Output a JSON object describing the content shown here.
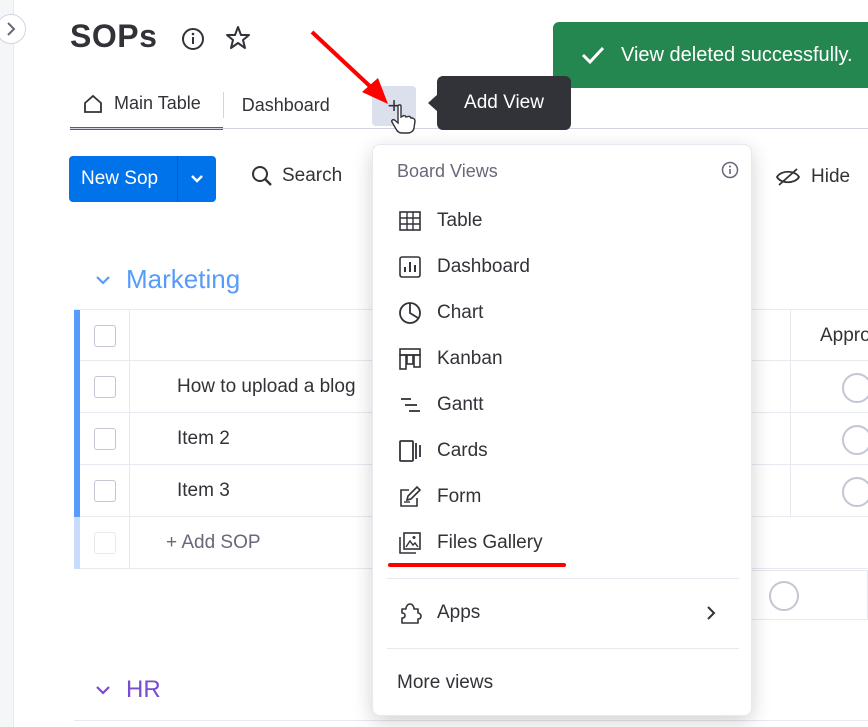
{
  "board": {
    "title": "SOPs"
  },
  "toast": {
    "message": "View deleted successfully."
  },
  "tabs": {
    "main": "Main Table",
    "dashboard": "Dashboard",
    "add": "+"
  },
  "tooltip": {
    "text": "Add View"
  },
  "toolbar": {
    "new_label": "New Sop",
    "search_label": "Search",
    "hide_label": "Hide"
  },
  "groups": {
    "marketing": {
      "title": "Marketing",
      "color": "#579bfc",
      "rows": [
        {
          "name": "How to upload a blog"
        },
        {
          "name": "Item 2"
        },
        {
          "name": "Item 3"
        }
      ],
      "add_label": "+ Add SOP",
      "column_approved": "Appro"
    },
    "hr": {
      "title": "HR",
      "color": "#784bd1"
    }
  },
  "menu": {
    "section_title": "Board Views",
    "items": [
      {
        "label": "Table",
        "icon": "table-icon"
      },
      {
        "label": "Dashboard",
        "icon": "dashboard-icon"
      },
      {
        "label": "Chart",
        "icon": "chart-icon"
      },
      {
        "label": "Kanban",
        "icon": "kanban-icon"
      },
      {
        "label": "Gantt",
        "icon": "gantt-icon"
      },
      {
        "label": "Cards",
        "icon": "cards-icon"
      },
      {
        "label": "Form",
        "icon": "form-icon"
      },
      {
        "label": "Files Gallery",
        "icon": "files-gallery-icon"
      }
    ],
    "apps_label": "Apps",
    "more_label": "More views"
  },
  "colors": {
    "accent": "#0073ea",
    "toast": "#258750",
    "annotation": "#ff0000"
  }
}
